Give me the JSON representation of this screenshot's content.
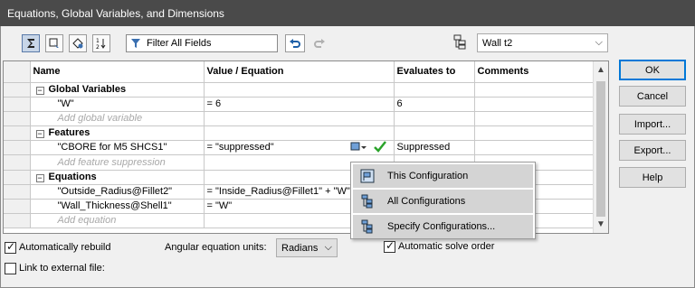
{
  "window": {
    "title": "Equations, Global Variables, and Dimensions"
  },
  "toolbar": {
    "filter_label": "Filter All Fields",
    "configuration_value": "Wall t2",
    "buttons": [
      "equation-view-icon",
      "sketch-equation-view-icon",
      "dimension-view-icon",
      "ordered-view-icon"
    ]
  },
  "grid": {
    "headers": [
      "Name",
      "Value / Equation",
      "Evaluates to",
      "Comments"
    ],
    "sections": {
      "global": {
        "title": "Global Variables",
        "rows": [
          {
            "name": "\"W\"",
            "value": "= 6",
            "evaluates": "6",
            "comment": ""
          }
        ],
        "placeholder": "Add global variable"
      },
      "features": {
        "title": "Features",
        "rows": [
          {
            "name": "\"CBORE for M5 SHCS1\"",
            "value": "= \"suppressed\"",
            "evaluates": "Suppressed",
            "comment": ""
          }
        ],
        "placeholder": "Add feature suppression"
      },
      "equations": {
        "title": "Equations",
        "rows": [
          {
            "name": "\"Outside_Radius@Fillet2\"",
            "value": "= \"Inside_Radius@Fillet1\" + \"W\"",
            "evaluates": "",
            "comment": ""
          },
          {
            "name": "\"Wall_Thickness@Shell1\"",
            "value": "= \"W\"",
            "evaluates": "",
            "comment": ""
          }
        ],
        "placeholder": "Add equation"
      }
    }
  },
  "popup": {
    "items": [
      "This Configuration",
      "All Configurations",
      "Specify Configurations..."
    ]
  },
  "buttons": {
    "ok": "OK",
    "cancel": "Cancel",
    "import": "Import...",
    "export": "Export...",
    "help": "Help"
  },
  "bottom": {
    "auto_rebuild": {
      "label": "Automatically rebuild",
      "checked": true
    },
    "angular_units_label": "Angular equation units:",
    "angular_units_value": "Radians",
    "auto_solve": {
      "label": "Automatic solve order",
      "checked": true
    },
    "link_external": {
      "label": "Link to external file:",
      "checked": false
    }
  },
  "colors": {
    "title_bar": "#4a4a4a",
    "accent": "#0078d7",
    "check_green": "#2aa32a"
  }
}
